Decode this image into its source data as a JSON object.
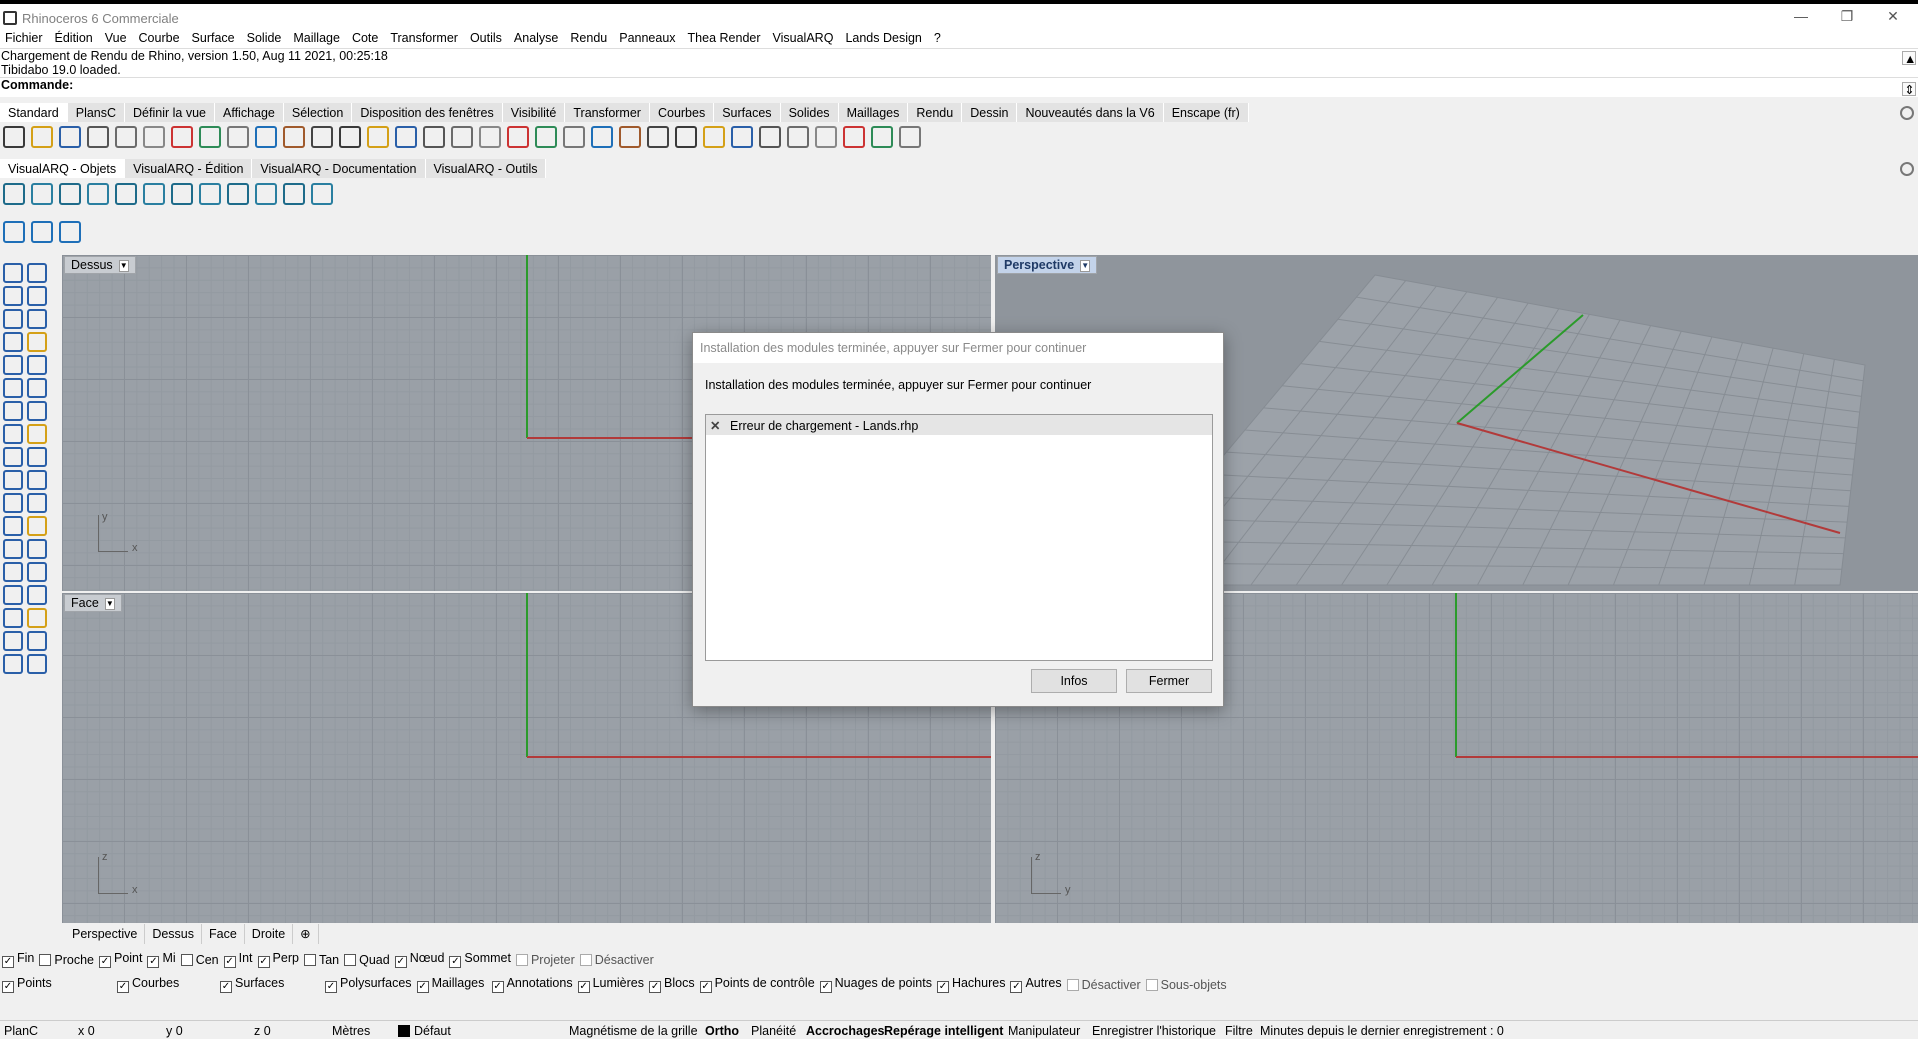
{
  "app": {
    "title": "Rhinoceros 6 Commerciale"
  },
  "menu": [
    "Fichier",
    "Édition",
    "Vue",
    "Courbe",
    "Surface",
    "Solide",
    "Maillage",
    "Cote",
    "Transformer",
    "Outils",
    "Analyse",
    "Rendu",
    "Panneaux",
    "Thea Render",
    "VisualARQ",
    "Lands Design",
    "?"
  ],
  "command_history": [
    "Chargement de Rendu de Rhino, version 1.50, Aug 11 2021, 00:25:18",
    "Tibidabo 19.0 loaded."
  ],
  "command_prompt": "Commande:",
  "toolbar_tabs": [
    "Standard",
    "PlansC",
    "Définir la vue",
    "Affichage",
    "Sélection",
    "Disposition des fenêtres",
    "Visibilité",
    "Transformer",
    "Courbes",
    "Surfaces",
    "Solides",
    "Maillages",
    "Rendu",
    "Dessin",
    "Nouveautés dans la V6",
    "Enscape (fr)"
  ],
  "visualarq_tabs": [
    "VisualARQ - Objets",
    "VisualARQ - Édition",
    "VisualARQ - Documentation",
    "VisualARQ - Outils"
  ],
  "viewports": {
    "top": {
      "label": "Dessus",
      "axes": [
        "y",
        "x"
      ]
    },
    "perspective": {
      "label": "Perspective"
    },
    "front": {
      "label": "Face",
      "axes": [
        "z",
        "x"
      ]
    },
    "right": {
      "axes": [
        "z",
        "y"
      ]
    }
  },
  "viewport_tabs": [
    "Perspective",
    "Dessus",
    "Face",
    "Droite",
    "⊕"
  ],
  "osnaps": [
    {
      "label": "Fin",
      "checked": true
    },
    {
      "label": "Proche",
      "checked": false
    },
    {
      "label": "Point",
      "checked": true
    },
    {
      "label": "Mi",
      "checked": true
    },
    {
      "label": "Cen",
      "checked": false
    },
    {
      "label": "Int",
      "checked": true
    },
    {
      "label": "Perp",
      "checked": true
    },
    {
      "label": "Tan",
      "checked": false
    },
    {
      "label": "Quad",
      "checked": false
    },
    {
      "label": "Nœud",
      "checked": true
    },
    {
      "label": "Sommet",
      "checked": true
    },
    {
      "label": "Projeter",
      "checked": false,
      "disabled": true
    },
    {
      "label": "Désactiver",
      "checked": false,
      "disabled": true
    }
  ],
  "filters": [
    {
      "label": "Points",
      "checked": true
    },
    {
      "label": "Courbes",
      "checked": true
    },
    {
      "label": "Surfaces",
      "checked": true
    },
    {
      "label": "Polysurfaces",
      "checked": true
    },
    {
      "label": "Maillages",
      "checked": true
    },
    {
      "label": "Annotations",
      "checked": true
    },
    {
      "label": "Lumières",
      "checked": true
    },
    {
      "label": "Blocs",
      "checked": true
    },
    {
      "label": "Points de contrôle",
      "checked": true
    },
    {
      "label": "Nuages de points",
      "checked": true
    },
    {
      "label": "Hachures",
      "checked": true
    },
    {
      "label": "Autres",
      "checked": true
    },
    {
      "label": "Désactiver",
      "checked": false,
      "disabled": true
    },
    {
      "label": "Sous-objets",
      "checked": false,
      "disabled": true
    }
  ],
  "status": {
    "plane": "PlanC",
    "x": "x 0",
    "y": "y 0",
    "z": "z 0",
    "units": "Mètres",
    "layer": "Défaut",
    "toggles": [
      "Magnétisme de la grille",
      "Ortho",
      "Planéité",
      "Accrochages",
      "Repérage intelligent",
      "Manipulateur",
      "Enregistrer l'historique",
      "Filtre"
    ],
    "save_info": "Minutes depuis le dernier enregistrement : 0"
  },
  "dialog": {
    "title": "Installation des modules terminée, appuyer sur Fermer pour continuer",
    "message": "Installation des modules terminée, appuyer sur Fermer pour continuer",
    "items": [
      "Erreur de chargement - Lands.rhp"
    ],
    "info_button": "Infos",
    "close_button": "Fermer"
  },
  "colors": {
    "viewport_bg": "#9aa0a7",
    "x_axis": "#b23a3a",
    "y_axis": "#2b9b2b",
    "active_viewport": "#c3d3ea"
  }
}
